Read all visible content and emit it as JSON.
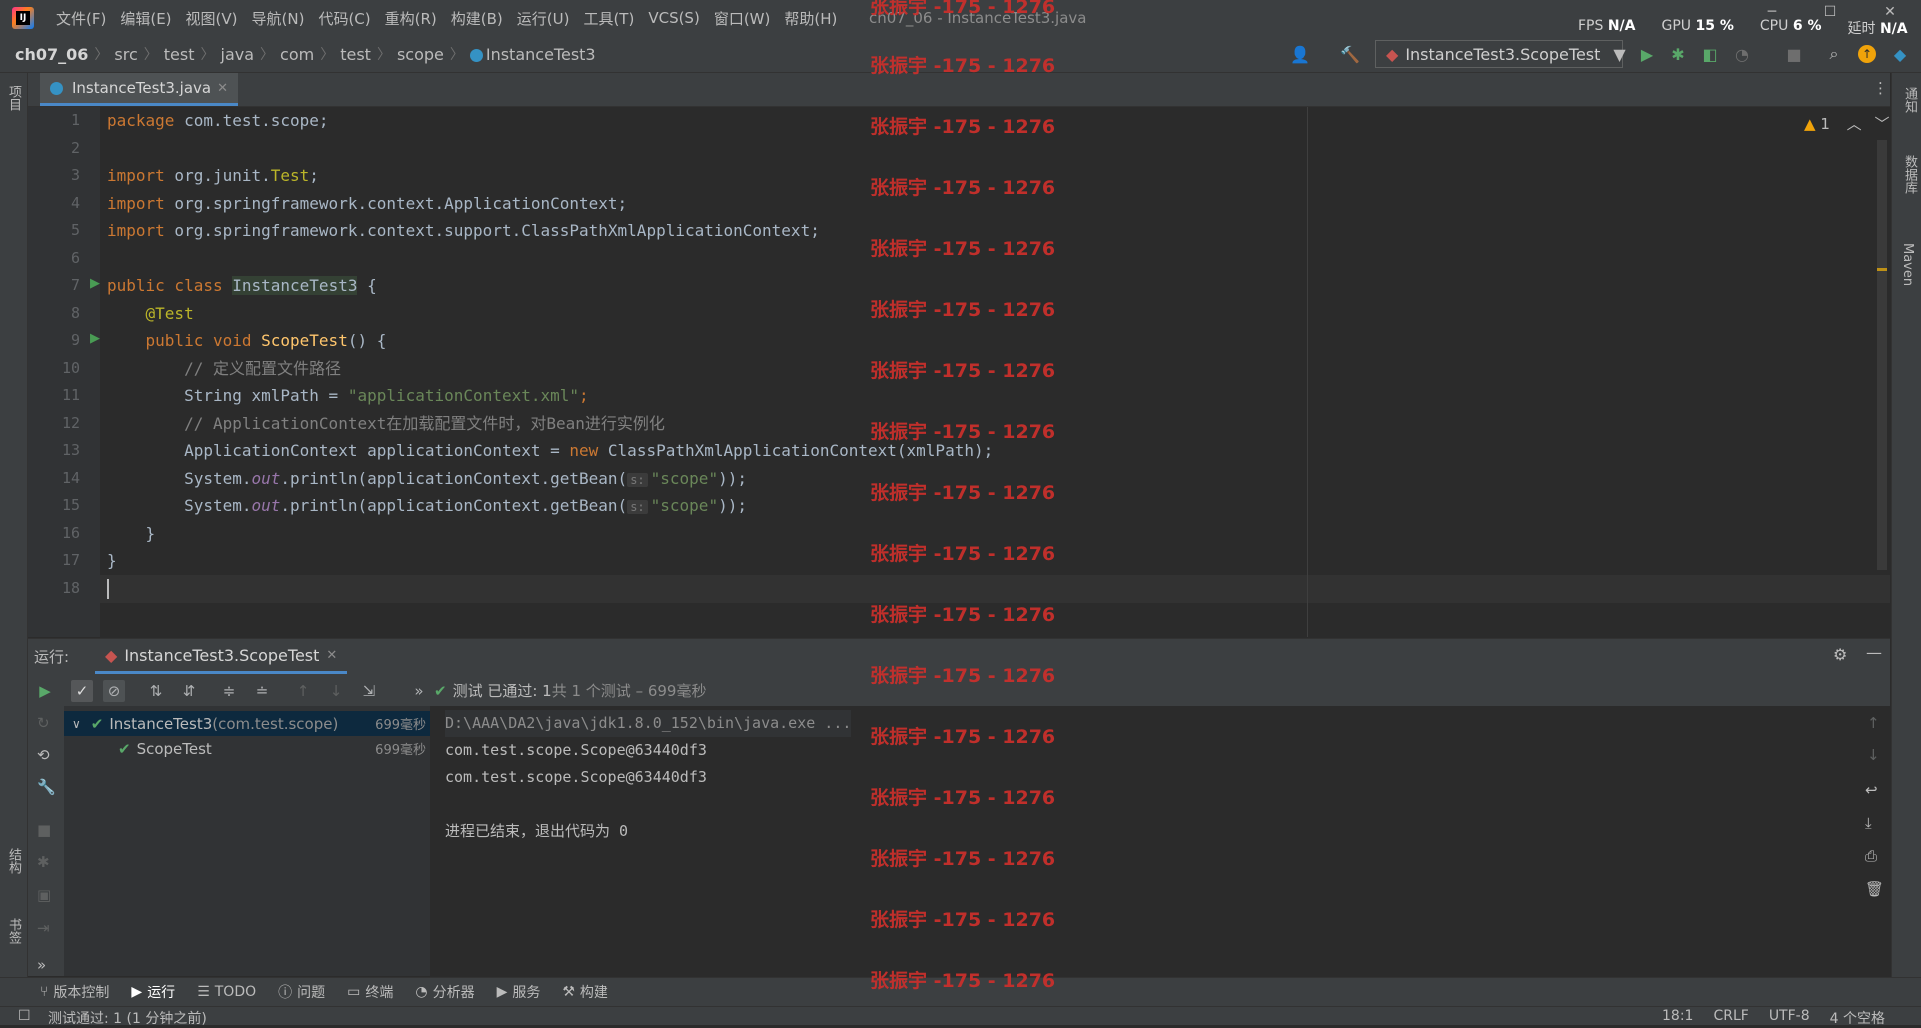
{
  "menu": [
    "文件(F)",
    "编辑(E)",
    "视图(V)",
    "导航(N)",
    "代码(C)",
    "重构(R)",
    "构建(B)",
    "运行(U)",
    "工具(T)",
    "VCS(S)",
    "窗口(W)",
    "帮助(H)"
  ],
  "window_title": "ch07_06 - InstanceTest3.java",
  "perf": {
    "fps_label": "FPS",
    "fps_value": "N/A",
    "gpu_label": "GPU",
    "gpu_value": "15 %",
    "cpu_label": "CPU",
    "cpu_value": "6 %",
    "latency_label": "延时",
    "latency_value": "N/A"
  },
  "breadcrumb": {
    "project": "ch07_06",
    "items": [
      "src",
      "test",
      "java",
      "com",
      "test",
      "scope"
    ],
    "file": "InstanceTest3"
  },
  "run_config": "InstanceTest3.ScopeTest",
  "left_tabs": {
    "project": "项目",
    "structure": "结构",
    "bookmarks": "书签"
  },
  "right_tabs": {
    "notifications": "通知",
    "database": "数据库",
    "maven": "Maven"
  },
  "editor": {
    "tab_label": "InstanceTest3.java",
    "warnings": "1",
    "line_numbers": [
      "1",
      "2",
      "3",
      "4",
      "5",
      "6",
      "7",
      "8",
      "9",
      "10",
      "11",
      "12",
      "13",
      "14",
      "15",
      "16",
      "17",
      "18"
    ],
    "lines": {
      "l1_kw": "package",
      "l1_rest": " com.test.scope;",
      "l3_kw": "import",
      "l3_rest": " org.junit.",
      "l3_ann": "Test",
      "l3_end": ";",
      "l4_kw": "import",
      "l4_rest": " org.springframework.context.ApplicationContext;",
      "l5_kw": "import",
      "l5_rest": " org.springframework.context.support.ClassPathXmlApplicationContext;",
      "l7_kw": "public class ",
      "l7_cls": "InstanceTest3",
      "l7_rest": " {",
      "l8_ann": "    @Test",
      "l9_kw": "    public void ",
      "l9_fn": "ScopeTest",
      "l9_rest": "() {",
      "l10_cm": "        // 定义配置文件路径",
      "l11_a": "        String xmlPath = ",
      "l11_str": "\"applicationContext.xml\"",
      "l11_end": ";",
      "l12_cm": "        // ApplicationContext在加载配置文件时，对Bean进行实例化",
      "l13_a": "        ApplicationContext applicationContext = ",
      "l13_kw": "new",
      "l13_rest": " ClassPathXmlApplicationContext(xmlPath);",
      "l14_a": "        System.",
      "l14_sf": "out",
      "l14_b": ".println(applicationContext.getBean(",
      "l14_hint": "s:",
      "l14_str": "\"scope\"",
      "l14_end": "));",
      "l15_a": "        System.",
      "l15_sf": "out",
      "l15_b": ".println(applicationContext.getBean(",
      "l15_hint": "s:",
      "l15_str": "\"scope\"",
      "l15_end": "));",
      "l16": "    }",
      "l17": "}"
    }
  },
  "run": {
    "label": "运行:",
    "tab_label": "InstanceTest3.ScopeTest",
    "status_prefix": "测试 已通过: ",
    "status_count": "1",
    "status_detail": "共 1 个测试 – 699毫秒",
    "tree": [
      {
        "name": "InstanceTest3",
        "pkg": " (com.test.scope)",
        "duration": "699毫秒"
      },
      {
        "name": "ScopeTest",
        "pkg": "",
        "duration": "699毫秒"
      }
    ],
    "console": [
      "D:\\AAA\\DA2\\java\\jdk1.8.0_152\\bin\\java.exe ...",
      "com.test.scope.Scope@63440df3",
      "com.test.scope.Scope@63440df3",
      "",
      "进程已结束，退出代码为 0"
    ]
  },
  "bottom_tabs": [
    "版本控制",
    "运行",
    "TODO",
    "问题",
    "终端",
    "分析器",
    "服务",
    "构建"
  ],
  "status": {
    "message": "测试通过: 1 (1 分钟之前)",
    "position": "18:1",
    "line_sep": "CRLF",
    "encoding": "UTF-8",
    "indent": "4 个空格"
  },
  "watermark": "张振宇 -175 - 1276"
}
